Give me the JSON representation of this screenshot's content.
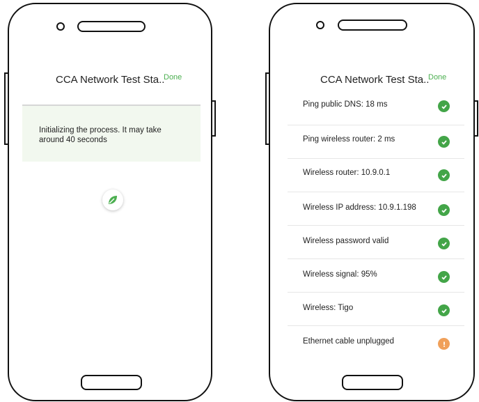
{
  "colors": {
    "accent": "#4caf50",
    "ok": "#43a548",
    "warning": "#f0a05a",
    "banner_bg": "#f2f8ef"
  },
  "left_screen": {
    "title": "CCA Network Test Sta..",
    "done_label": "Done",
    "message": "Initializing the process. It may take around 40 seconds",
    "spinner_icon": "leaf-icon"
  },
  "right_screen": {
    "title": "CCA Network Test Sta..",
    "done_label": "Done",
    "results": [
      {
        "label": "Ping public DNS: 18 ms",
        "status": "ok",
        "icon": "check-icon"
      },
      {
        "label": "Ping wireless router: 2 ms",
        "status": "ok",
        "icon": "check-icon"
      },
      {
        "label": "Wireless router: 10.9.0.1",
        "status": "ok",
        "icon": "check-icon"
      },
      {
        "label": "Wireless IP address: 10.9.1.198",
        "status": "ok",
        "icon": "check-icon"
      },
      {
        "label": "Wireless password valid",
        "status": "ok",
        "icon": "check-icon"
      },
      {
        "label": "Wireless signal: 95%",
        "status": "ok",
        "icon": "check-icon"
      },
      {
        "label": "Wireless: Tigo",
        "status": "ok",
        "icon": "check-icon"
      },
      {
        "label": "Ethernet cable unplugged",
        "status": "warn",
        "icon": "warning-icon"
      }
    ]
  }
}
